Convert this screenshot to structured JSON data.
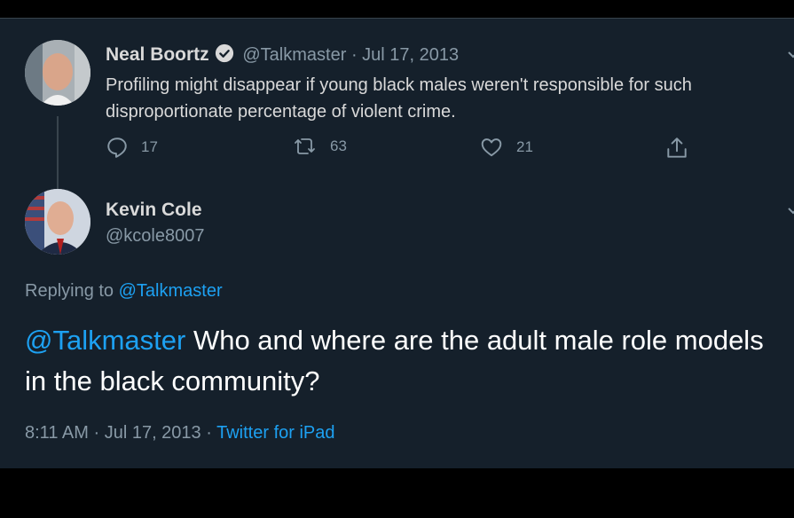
{
  "tweet1": {
    "name": "Neal Boortz",
    "handle": "@Talkmaster",
    "separator": "·",
    "date": "Jul 17, 2013",
    "text": "Profiling might disappear if young black males weren't responsible for such disproportionate percentage of violent crime.",
    "replies": "17",
    "retweets": "63",
    "likes": "21"
  },
  "tweet2": {
    "name": "Kevin Cole",
    "handle": "@kcole8007",
    "replying_prefix": "Replying to",
    "replying_handle": "@Talkmaster",
    "mention": "@Talkmaster",
    "text": " Who and where are the adult male role models in the black community?",
    "time": "8:11 AM",
    "sep1": "·",
    "date": "Jul 17, 2013",
    "sep2": "·",
    "source": "Twitter for iPad"
  },
  "colors": {
    "background": "#15202b",
    "accent": "#1da1f2",
    "muted": "#8899a6"
  }
}
